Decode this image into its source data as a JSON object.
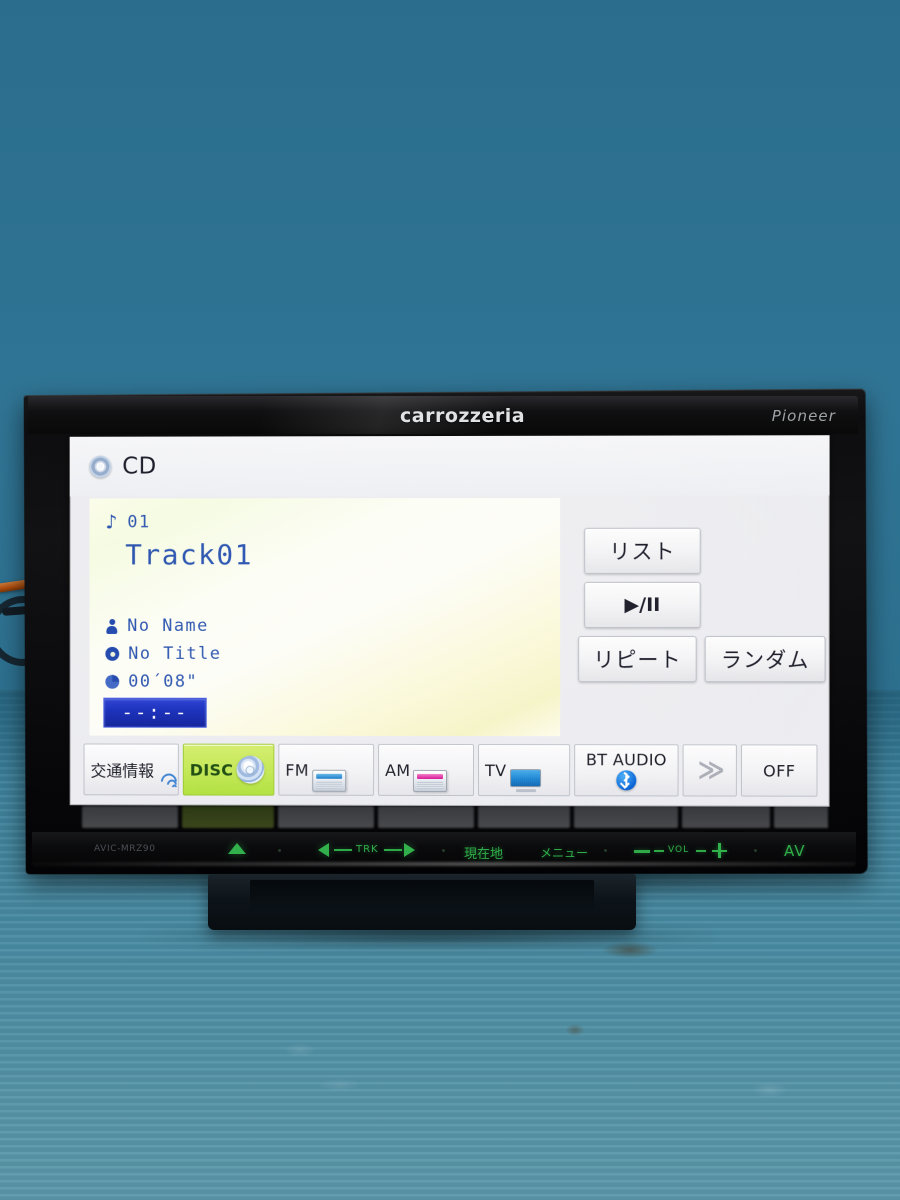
{
  "device": {
    "brand_left": "carrozzeria",
    "brand_right": "Pioneer",
    "model_code": "AVIC-MRZ90"
  },
  "screen": {
    "source_label": "CD",
    "source_icon": "cd-disc-icon",
    "now_playing": {
      "track_number": "01",
      "track_number_icon": "music-note-icon",
      "track_title": "Track01",
      "artist": "No Name",
      "artist_icon": "person-icon",
      "album": "No Title",
      "album_icon": "disc-icon",
      "elapsed_time": "00´08\"",
      "elapsed_icon": "clock-icon",
      "remaining_time": "--:--"
    },
    "controls": [
      {
        "id": "list",
        "label": "リスト",
        "name": "list-button"
      },
      {
        "id": "play_pause",
        "label": "▶/II",
        "name": "play-pause-button"
      },
      {
        "id": "repeat",
        "label": "リピート",
        "name": "repeat-button"
      },
      {
        "id": "random",
        "label": "ランダム",
        "name": "random-button"
      }
    ],
    "sources": [
      {
        "id": "traffic",
        "label": "交通情報",
        "icon": "wifi-waves-icon",
        "active": false
      },
      {
        "id": "disc",
        "label": "DISC",
        "icon": "cd-disc-icon",
        "active": true
      },
      {
        "id": "fm",
        "label": "FM",
        "icon": "radio-fm-icon",
        "active": false
      },
      {
        "id": "am",
        "label": "AM",
        "icon": "radio-am-icon",
        "active": false
      },
      {
        "id": "tv",
        "label": "TV",
        "icon": "television-icon",
        "active": false
      },
      {
        "id": "bt_audio",
        "label": "BT AUDIO",
        "icon": "bluetooth-icon",
        "active": false
      },
      {
        "id": "next_page",
        "label": "≫",
        "icon": "double-chevron-right-icon",
        "active": false
      },
      {
        "id": "off",
        "label": "OFF",
        "icon": "",
        "active": false
      }
    ]
  },
  "hard_keys": {
    "eject": "eject-icon",
    "track_prev": "track-previous-icon",
    "track_label": "TRK",
    "track_next": "track-next-icon",
    "current_location": "現在地",
    "menu": "メニュー",
    "volume_down": "volume-minus-icon",
    "volume_label": "VOL",
    "volume_up": "volume-plus-icon",
    "av": "AV"
  },
  "colors": {
    "background_wall": "#2d6e8e",
    "background_floor": "#4a8ca3",
    "accent_green": "#b8e050",
    "lcd_blue_text": "#2a4fa8",
    "time_box_blue": "#1b2fb6",
    "key_green": "#31b04c"
  }
}
